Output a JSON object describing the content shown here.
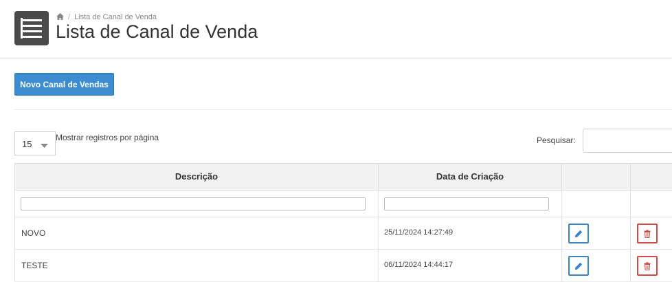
{
  "header": {
    "breadcrumb": {
      "home_icon": "home-icon",
      "separator": "/",
      "current": "Lista de Canal de Venda"
    },
    "title": "Lista de Canal de Venda",
    "menu_icon": "list-icon"
  },
  "toolbar": {
    "new_button_label": "Novo Canal de Vendas"
  },
  "controls": {
    "page_size_value": "15",
    "page_size_label": "Mostrar registros por página",
    "search_label": "Pesquisar:"
  },
  "table": {
    "columns": [
      "Descrição",
      "Data de Criação",
      "",
      ""
    ],
    "rows": [
      {
        "descricao": "NOVO",
        "data": "25/11/2024 14:27:49"
      },
      {
        "descricao": "TESTE",
        "data": "06/11/2024 14:44:17"
      }
    ]
  },
  "colors": {
    "primary": "#3c8dd0",
    "edit": "#3c82c4",
    "delete": "#d14b4b",
    "header_icon_bg": "#4a4a4a"
  }
}
